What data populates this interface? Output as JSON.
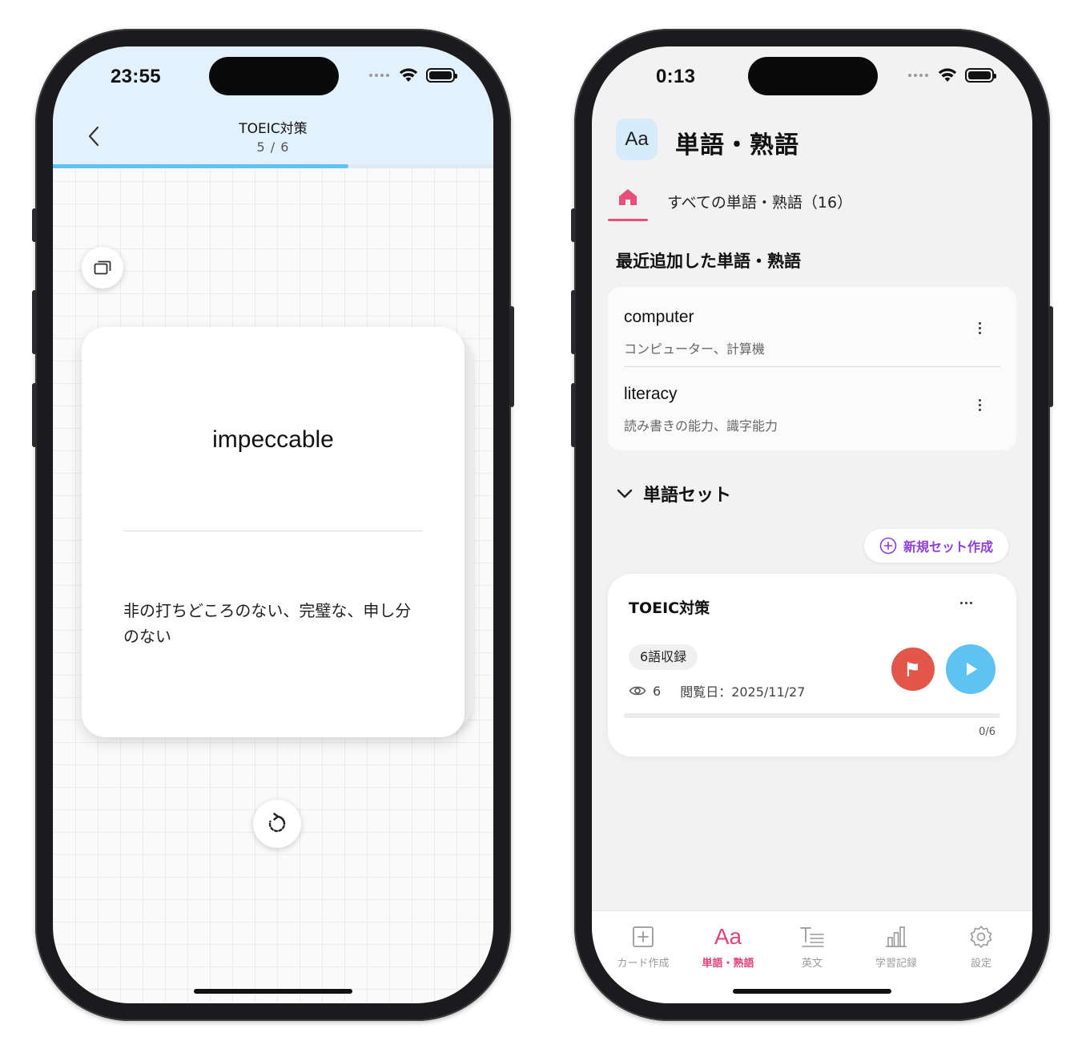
{
  "left_phone": {
    "status": {
      "time": "23:55"
    },
    "nav": {
      "title": "TOEIC対策",
      "counter": "5 / 6",
      "progress": 0.67
    },
    "card": {
      "word": "impeccable",
      "meaning": "非の打ちどころのない、完璧な、申し分のない"
    },
    "colors": {
      "header_bg": "#e3f1fc",
      "progress": "#5ec3f2"
    }
  },
  "right_phone": {
    "status": {
      "time": "0:13"
    },
    "header": {
      "icon_text": "Aa",
      "title": "単語・熟語"
    },
    "all_tab": {
      "label": "すべての単語・熟語（16）",
      "icon": "home-icon"
    },
    "recent": {
      "title": "最近追加した単語・熟語",
      "items": [
        {
          "word": "computer",
          "meaning": "コンピューター、計算機"
        },
        {
          "word": "literacy",
          "meaning": "読み書きの能力、識字能力"
        }
      ]
    },
    "word_sets": {
      "title": "単語セット",
      "new_set_label": "新規セット作成",
      "sets": [
        {
          "name": "TOEIC対策",
          "count_label": "6語収録",
          "views": "6",
          "viewed_date": "閲覧日：2025/11/27",
          "progress_label": "0/6",
          "progress": 0
        }
      ]
    },
    "tabbar": [
      {
        "label": "カード作成",
        "icon": "plus-square-icon",
        "active": false
      },
      {
        "label": "単語・熟語",
        "icon": "aa-icon",
        "active": true
      },
      {
        "label": "英文",
        "icon": "text-icon",
        "active": false
      },
      {
        "label": "学習記録",
        "icon": "bar-chart-icon",
        "active": false
      },
      {
        "label": "設定",
        "icon": "gear-icon",
        "active": false
      }
    ],
    "colors": {
      "accent": "#e0447a",
      "flag": "#e2564b",
      "play": "#5ec3f2",
      "new_set": "#8e3fd9"
    }
  }
}
